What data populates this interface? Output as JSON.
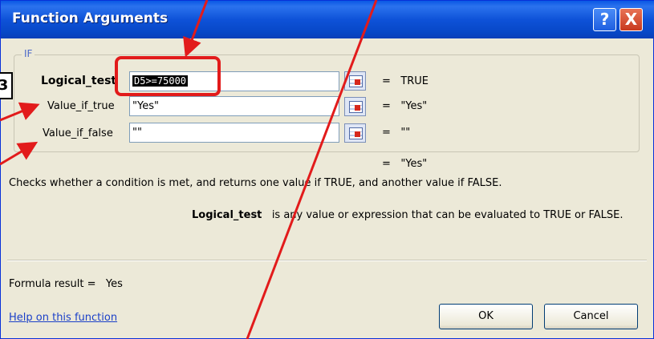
{
  "dialog": {
    "title": "Function Arguments",
    "help_glyph": "?",
    "close_glyph": "X",
    "group_label": "IF",
    "args": [
      {
        "label": "Logical_test",
        "value": "D5>=75000",
        "result": "TRUE"
      },
      {
        "label": "Value_if_true",
        "value": "\"Yes\"",
        "result": "\"Yes\""
      },
      {
        "label": "Value_if_false",
        "value": "\"\"",
        "result": "\"\""
      }
    ],
    "equals": "=",
    "overall_result": "\"Yes\"",
    "description": "Checks whether a condition is met, and returns one value if TRUE, and another value if FALSE.",
    "arg_help_name": "Logical_test",
    "arg_help_text": "is any value or expression that can be evaluated to TRUE or FALSE.",
    "formula_result_label": "Formula result =",
    "formula_result_value": "Yes",
    "help_link": "Help on this function",
    "ok_label": "OK",
    "cancel_label": "Cancel"
  },
  "annotations": {
    "callout_label": "3",
    "highlight_color": "#e21b1b",
    "arrow_color": "#e21b1b"
  },
  "colors": {
    "titlebar": "#0a58e4",
    "dialog_bg": "#ece9d8",
    "link": "#1a3fc8"
  }
}
